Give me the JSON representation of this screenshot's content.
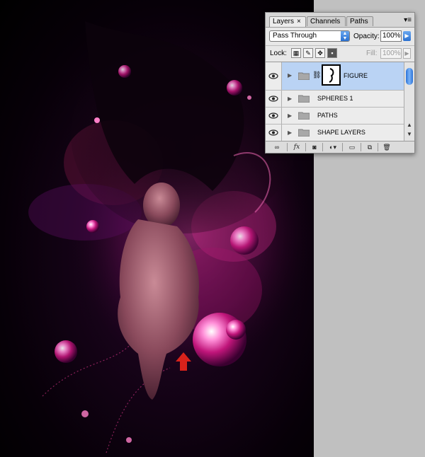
{
  "panel": {
    "tabs": [
      {
        "label": "Layers",
        "close": "×"
      },
      {
        "label": "Channels"
      },
      {
        "label": "Paths"
      }
    ],
    "menu_glyph": "▾≡",
    "blend_mode": "Pass Through",
    "opacity_label": "Opacity:",
    "opacity_value": "100%",
    "lock_label": "Lock:",
    "fill_label": "Fill:",
    "fill_value": "100%",
    "layers": [
      {
        "name": "FIGURE",
        "selected": true,
        "icon": "folder-icon",
        "has_mask": true
      },
      {
        "name": "SPHERES 1",
        "selected": false,
        "icon": "folder-icon"
      },
      {
        "name": "PATHS",
        "selected": false,
        "icon": "folder-icon"
      },
      {
        "name": "SHAPE LAYERS",
        "selected": false,
        "icon": "folder-icon"
      }
    ],
    "bottom_buttons": {
      "link": "link-layers-icon",
      "fx": "fx",
      "mask": "add-mask-icon",
      "adjustment": "adjustment-layer-icon",
      "group": "new-group-icon",
      "new_layer": "new-layer-icon",
      "delete": "trash-icon"
    },
    "accent_color": "#3d7fe0",
    "selected_row_color": "#bad3f4"
  },
  "canvas": {
    "description_icons": [
      "red-arrow-icon"
    ],
    "arrow_color": "#d8221b"
  }
}
